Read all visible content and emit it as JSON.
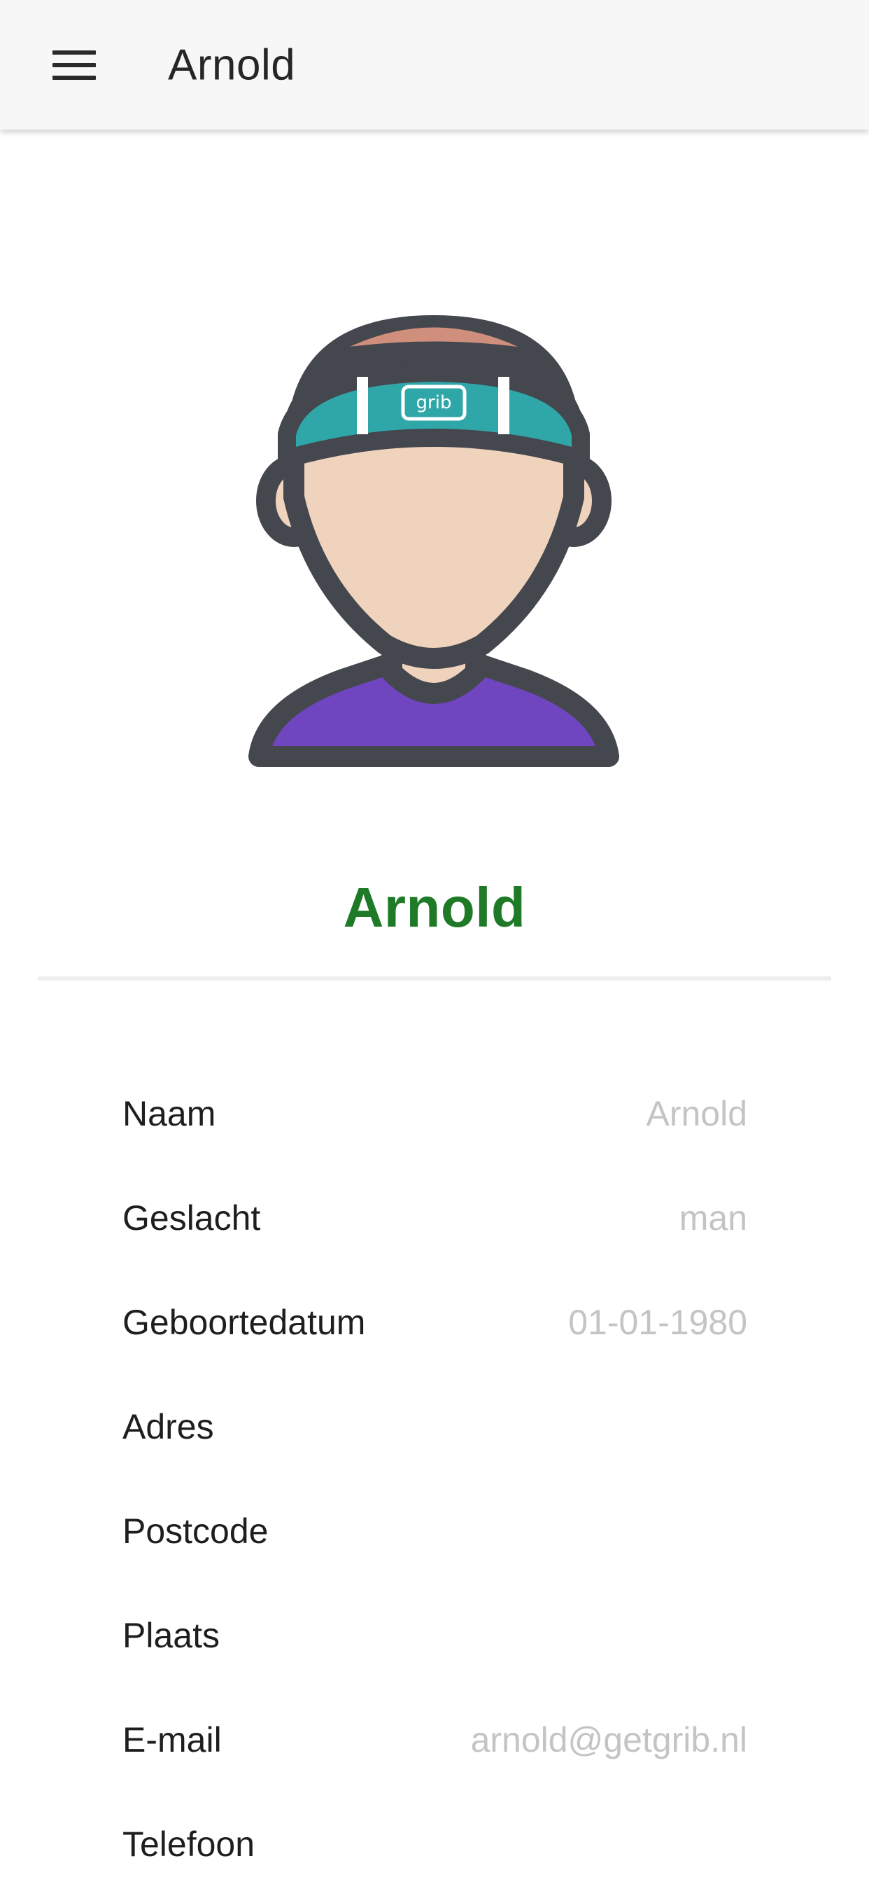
{
  "app_bar": {
    "title": "Arnold"
  },
  "profile": {
    "name": "Arnold",
    "avatar_badge_text": "grib",
    "name_color": "#1e7a26"
  },
  "fields": [
    {
      "label": "Naam",
      "value": "Arnold"
    },
    {
      "label": "Geslacht",
      "value": "man"
    },
    {
      "label": "Geboortedatum",
      "value": "01-01-1980"
    },
    {
      "label": "Adres",
      "value": ""
    },
    {
      "label": "Postcode",
      "value": ""
    },
    {
      "label": "Plaats",
      "value": ""
    },
    {
      "label": "E-mail",
      "value": "arnold@getgrib.nl"
    },
    {
      "label": "Telefoon",
      "value": ""
    }
  ]
}
